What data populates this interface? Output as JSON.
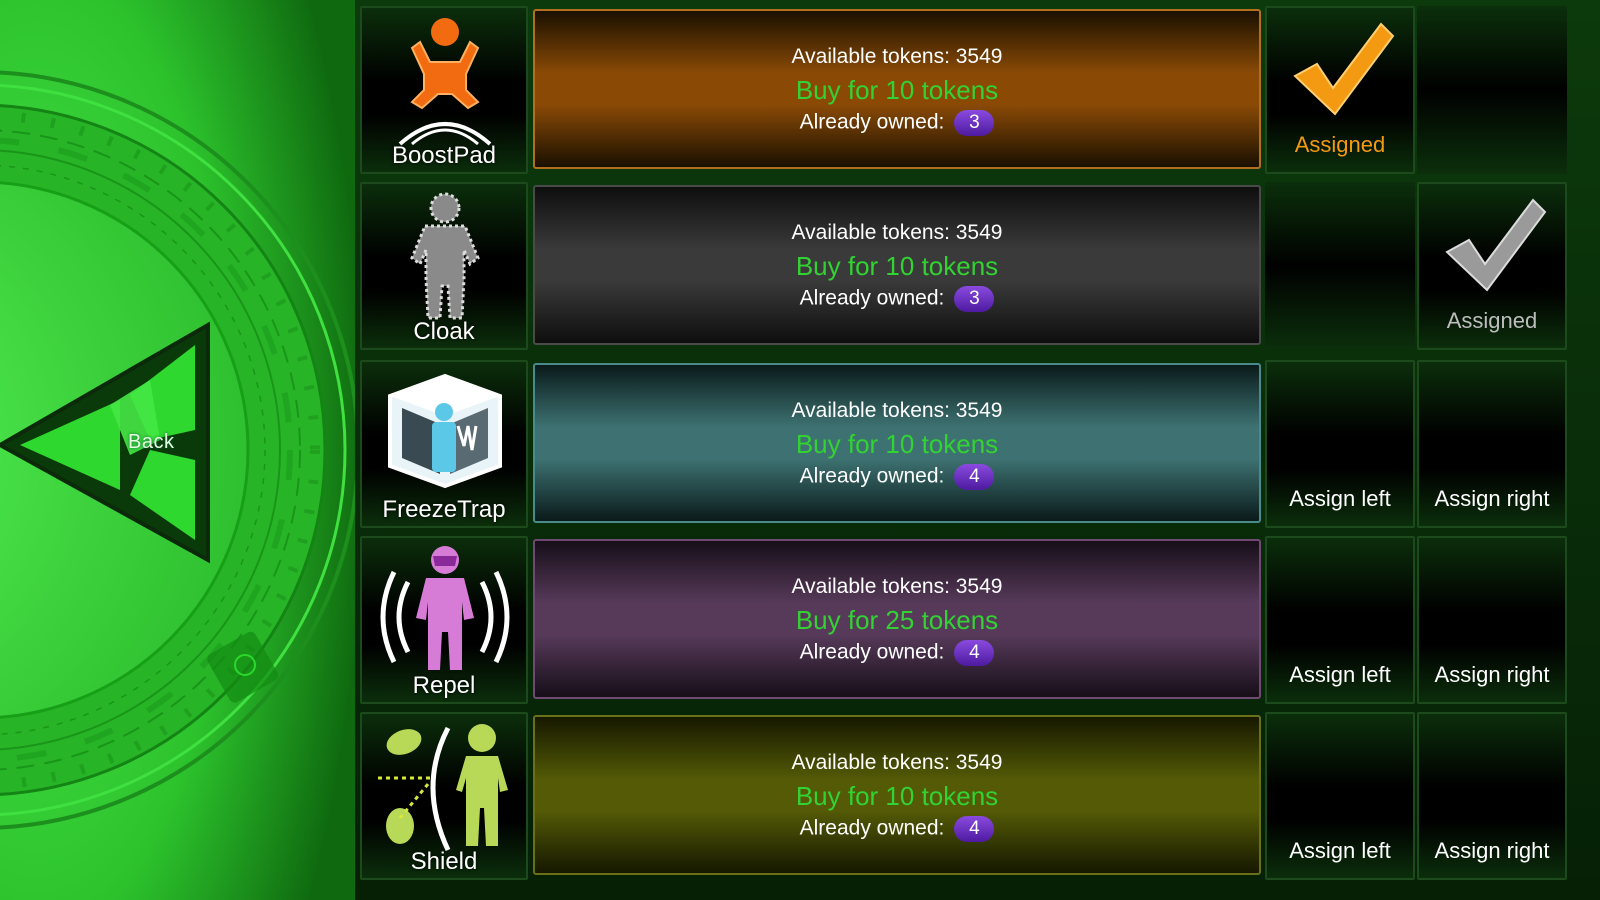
{
  "back": {
    "label": "Back",
    "color": "#2fd82f"
  },
  "items": [
    {
      "name": "BoostPad",
      "icon": "boostpad-icon",
      "tokens_label": "Available tokens: 3549",
      "buy_label": "Buy for 10 tokens",
      "owned_label": "Already owned:",
      "owned_count": "3",
      "panel_color": "#8a4a06",
      "left_slot": "Assigned",
      "right_slot": "",
      "assigned_side": "left",
      "check_color": "#f39a12"
    },
    {
      "name": "Cloak",
      "icon": "cloak-icon",
      "tokens_label": "Available tokens: 3549",
      "buy_label": "Buy for 10 tokens",
      "owned_label": "Already owned:",
      "owned_count": "3",
      "panel_color": "#3a3a3a",
      "left_slot": "",
      "right_slot": "Assigned",
      "assigned_side": "right",
      "check_color": "#bdbdbd"
    },
    {
      "name": "FreezeTrap",
      "icon": "freezetrap-icon",
      "tokens_label": "Available tokens: 3549",
      "buy_label": "Buy for 10 tokens",
      "owned_label": "Already owned:",
      "owned_count": "4",
      "panel_color": "#3e7272",
      "left_slot": "Assign left",
      "right_slot": "Assign right",
      "assigned_side": "none",
      "check_color": ""
    },
    {
      "name": "Repel",
      "icon": "repel-icon",
      "tokens_label": "Available tokens: 3549",
      "buy_label": "Buy for 25 tokens",
      "owned_label": "Already owned:",
      "owned_count": "4",
      "panel_color": "#573a5a",
      "left_slot": "Assign left",
      "right_slot": "Assign right",
      "assigned_side": "none",
      "check_color": ""
    },
    {
      "name": "Shield",
      "icon": "shield-icon",
      "tokens_label": "Available tokens: 3549",
      "buy_label": "Buy for 10 tokens",
      "owned_label": "Already owned:",
      "owned_count": "4",
      "panel_color": "#545a06",
      "left_slot": "Assign left",
      "right_slot": "Assign right",
      "assigned_side": "none",
      "check_color": ""
    }
  ]
}
